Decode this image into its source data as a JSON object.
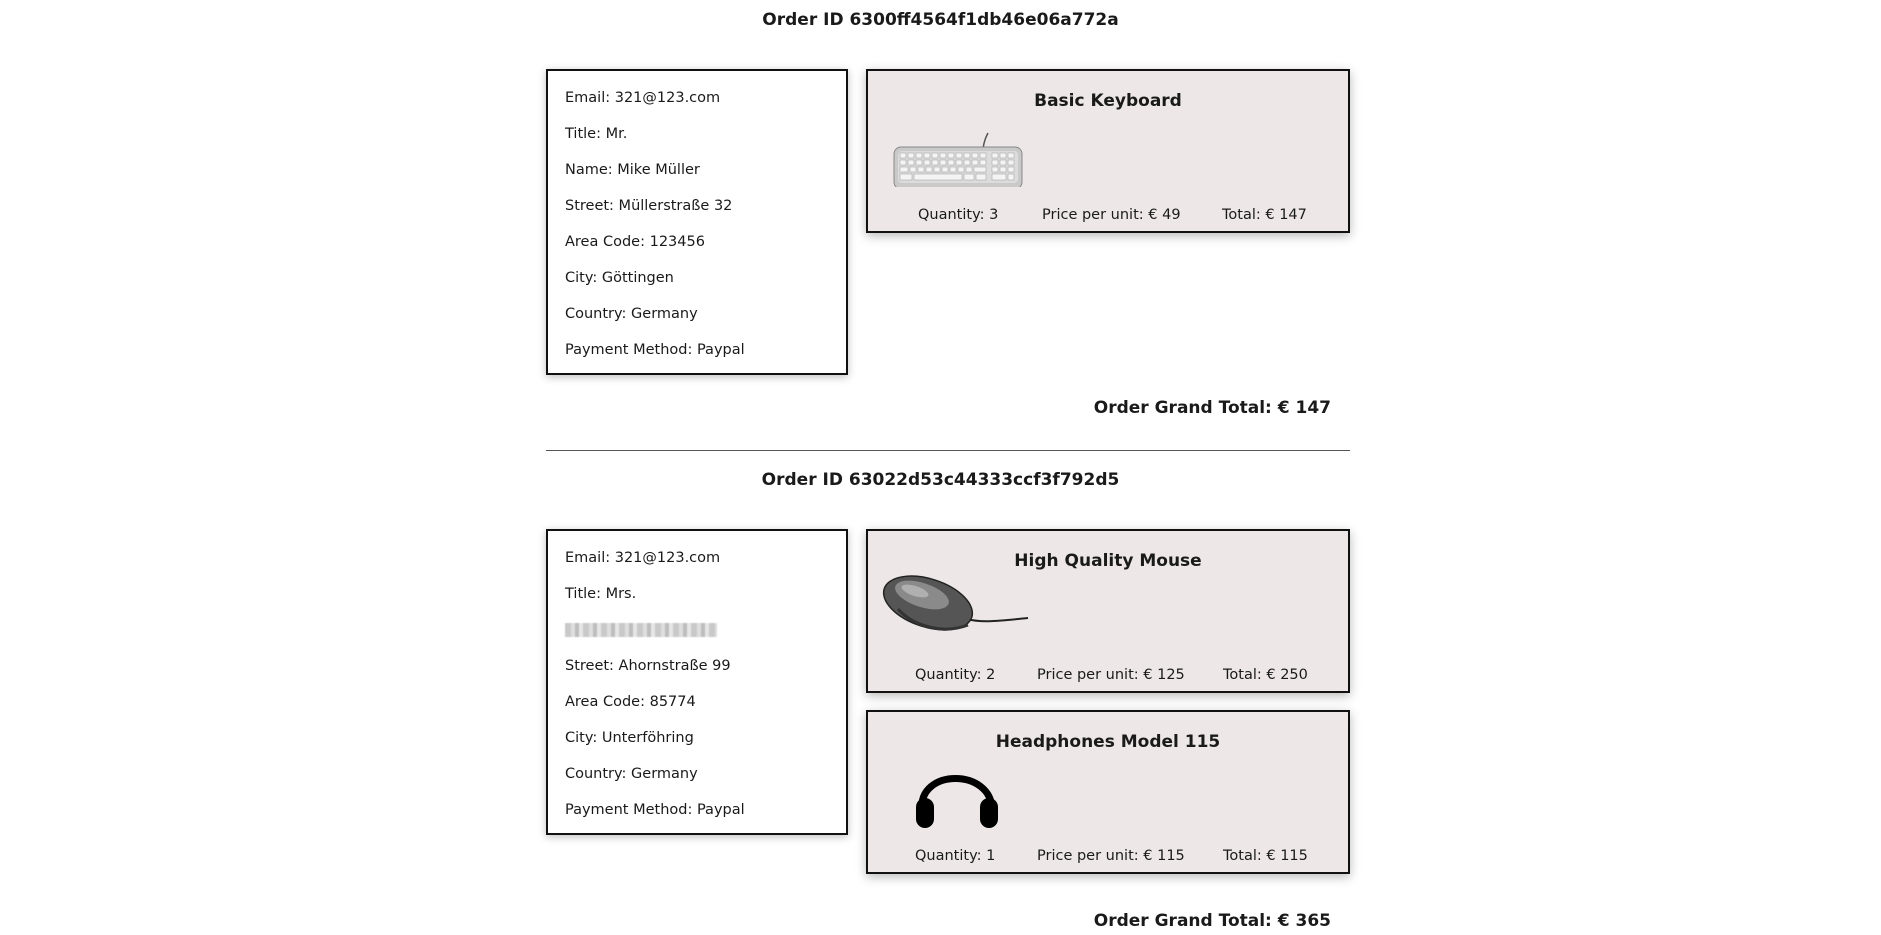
{
  "orders": [
    {
      "title": "Order ID 6300ff4564f1db46e06a772a",
      "customer": {
        "email": "Email: 321@123.com",
        "title": "Title: Mr.",
        "name": "Name: Mike Müller",
        "street": "Street: Müllerstraße 32",
        "area_code": "Area Code: 123456",
        "city": "City: Göttingen",
        "country": "Country: Germany",
        "payment": "Payment Method: Paypal"
      },
      "products": [
        {
          "name": "Basic Keyboard",
          "icon": "keyboard-icon",
          "quantity": "Quantity: 3",
          "price": "Price per unit: € 49",
          "total": "Total: € 147"
        }
      ],
      "grand_total": "Order Grand Total: € 147"
    },
    {
      "title": "Order ID 63022d53c44333ccf3f792d5",
      "customer": {
        "email": "Email: 321@123.com",
        "title": "Title: Mrs.",
        "name": "",
        "street": "Street: Ahornstraße 99",
        "area_code": "Area Code: 85774",
        "city": "City: Unterföhring",
        "country": "Country: Germany",
        "payment": "Payment Method: Paypal"
      },
      "products": [
        {
          "name": "High Quality Mouse",
          "icon": "mouse-icon",
          "quantity": "Quantity: 2",
          "price": "Price per unit: € 125",
          "total": "Total: € 250"
        },
        {
          "name": "Headphones Model 115",
          "icon": "headphones-icon",
          "quantity": "Quantity: 1",
          "price": "Price per unit: € 115",
          "total": "Total: € 115"
        }
      ],
      "grand_total": "Order Grand Total: € 365"
    }
  ]
}
